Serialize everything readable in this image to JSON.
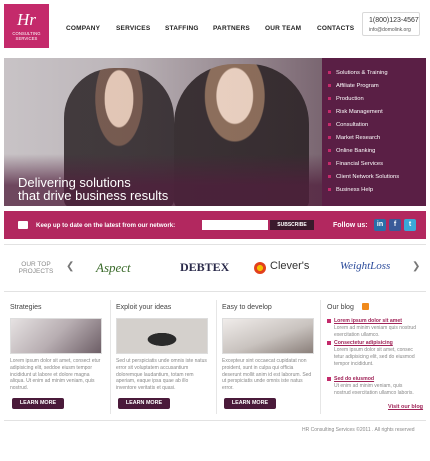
{
  "brand": {
    "mark": "Hr",
    "line1": "CONSULTING",
    "line2": "SERVICES"
  },
  "nav": [
    "COMPANY",
    "SERVICES",
    "STAFFING",
    "PARTNERS",
    "OUR TEAM",
    "CONTACTS"
  ],
  "contact": {
    "phone": "1(800)123-4567",
    "email": "info@domolink.org"
  },
  "hero": {
    "heading_line1": "Delivering solutions",
    "heading_line2": "that drive business results",
    "menu": [
      "Solutions & Training",
      "Affiliate Program",
      "Production",
      "Risk Management",
      "Consultation",
      "Market Research",
      "Online Banking",
      "Financial Services",
      "Client Network Solutions",
      "Business Help"
    ]
  },
  "subscribe": {
    "text": "Keep up to date on the latest from our network:",
    "input_value": "",
    "button": "SUBSCRIBE",
    "follow": "Follow us:",
    "social": [
      "in",
      "f",
      "t"
    ]
  },
  "projects": {
    "label": "OUR TOP PROJECTS",
    "logos": [
      "Aspect",
      "DEBTEX",
      "Clever's",
      "WeightLoss"
    ]
  },
  "columns": [
    {
      "title": "Strategies",
      "text": "Lorem ipsum dolor sit amet, consect etur adipisicing elit, seddoe eiusm tempor incididunt ut labore et dolore magna aliqua. Ut enim ad minim veniam, quis nostrud.",
      "button": "LEARN MORE"
    },
    {
      "title": "Exploit your ideas",
      "text": "Sed ut perspiciatis unde omnis iste natus error sit voluptatem accusantium doloremque laudantium, totam rem aperiam, eaque ipsa quae ab illo inventore veritatis et quasi.",
      "button": "LEARN MORE"
    },
    {
      "title": "Easy to develop",
      "text": "Excepteur sint occaecat cupidatat non proident, sunt in culpa qui officia deserunt mollit anim id est laborum. Sed ut perspiciatis unde omnis iste natus error.",
      "button": "LEARN MORE"
    }
  ],
  "blog": {
    "title": "Our blog",
    "posts": [
      {
        "heading": "Lorem ipsum dolor sit amet",
        "text": "Lorem ad minim veniam quis nostrud exercitation ullamco."
      },
      {
        "heading": "Consectetur adipisicing",
        "text": "Lorem ipsum dolor sit amet, consec tetur adipisicing elit, sed do eiusmod tempor incididunt."
      },
      {
        "heading": "Sed do eiusmod",
        "text": "Ut enim ad minim veniam, quis nostrud exercitation ullamco laboris."
      }
    ],
    "visit": "Visit our blog"
  },
  "footer": "HR Consulting Services ©2011 . All rights reserved",
  "colors": {
    "accent": "#c42a6b",
    "dark_purple": "#5a1f45",
    "bar": "#b2285f"
  }
}
